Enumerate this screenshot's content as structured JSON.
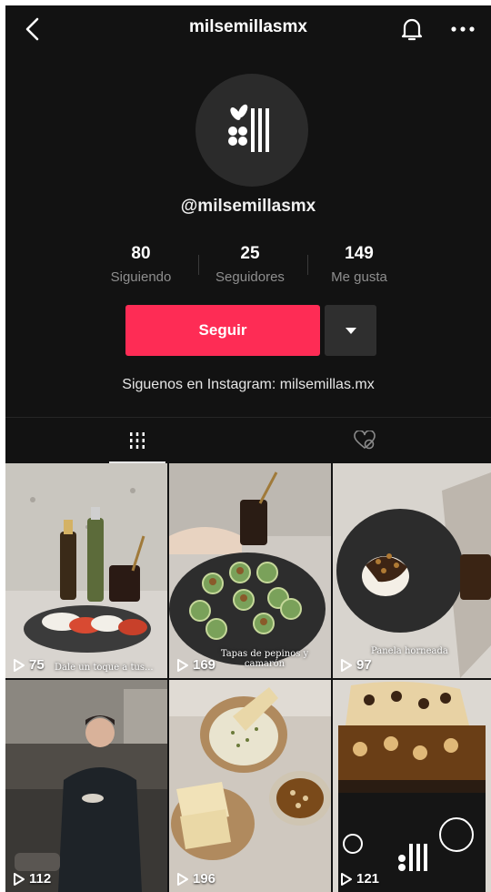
{
  "header": {
    "username": "milsemillasmx",
    "back_icon": "chevron-left-icon",
    "bell_icon": "bell-icon",
    "more_icon": "more-dots-icon"
  },
  "profile": {
    "handle": "@milsemillasmx",
    "stats": [
      {
        "value": "80",
        "label": "Siguiendo"
      },
      {
        "value": "25",
        "label": "Seguidores"
      },
      {
        "value": "149",
        "label": "Me gusta"
      }
    ],
    "follow_label": "Seguir",
    "bio": "Siguenos en Instagram: milsemillas.mx"
  },
  "tabs": [
    {
      "name": "videos",
      "icon": "grid-icon",
      "active": true
    },
    {
      "name": "liked",
      "icon": "liked-heart-icon",
      "active": false
    }
  ],
  "videos": [
    {
      "views": "75",
      "caption": "Dale un toque a tus..."
    },
    {
      "views": "169",
      "caption": "Tapas de pepinos y camarón"
    },
    {
      "views": "97",
      "caption": "Panela horneada"
    },
    {
      "views": "112",
      "caption": ""
    },
    {
      "views": "196",
      "caption": ""
    },
    {
      "views": "121",
      "caption": ""
    }
  ],
  "colors": {
    "background": "#121212",
    "accent": "#fe2c55",
    "secondary_button": "#2f2f2f"
  }
}
